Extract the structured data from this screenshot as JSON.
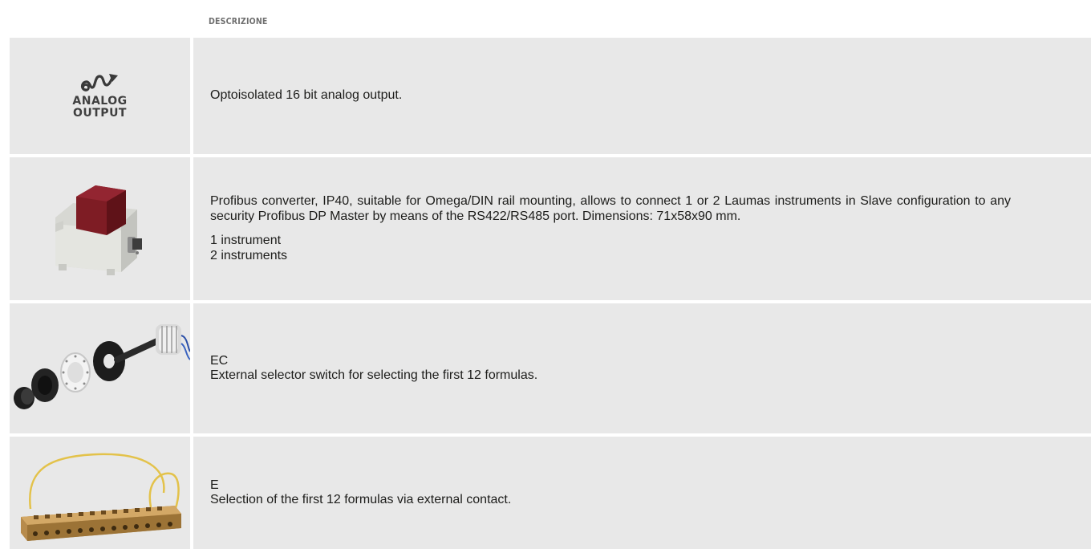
{
  "header": {
    "column_label": "DESCRIZIONE"
  },
  "rows": [
    {
      "icon_name": "analog-output-icon",
      "icon_label_line1": "ANALOG",
      "icon_label_line2": "OUTPUT",
      "description": "Optoisolated 16 bit analog output."
    },
    {
      "image_name": "profibus-converter-image",
      "description": "Profibus converter, IP40, suitable for Omega/DIN rail mounting, allows to connect 1 or 2 Laumas instruments in Slave configuration to any security Profibus DP Master by means of the RS422/RS485 port. Dimensions: 71x58x90 mm.",
      "options": [
        "1 instrument",
        "2 instruments"
      ]
    },
    {
      "image_name": "selector-switch-image",
      "code": "EC",
      "description": "External selector switch for selecting the first 12 formulas."
    },
    {
      "image_name": "terminal-block-image",
      "code": "E",
      "description": "Selection of the first 12 formulas via external contact."
    }
  ]
}
